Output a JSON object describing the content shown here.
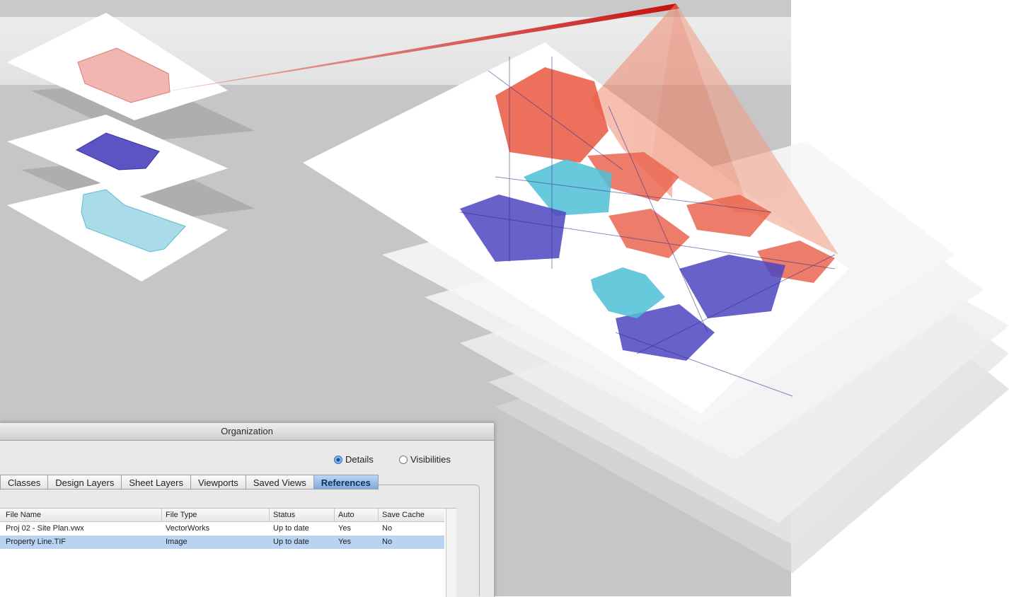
{
  "dialog": {
    "title": "Organization",
    "radios": [
      {
        "label": "Details",
        "selected": true
      },
      {
        "label": "Visibilities",
        "selected": false
      }
    ],
    "tabs": [
      {
        "label": "Classes",
        "active": false
      },
      {
        "label": "Design Layers",
        "active": false
      },
      {
        "label": "Sheet Layers",
        "active": false
      },
      {
        "label": "Viewports",
        "active": false
      },
      {
        "label": "Saved Views",
        "active": false
      },
      {
        "label": "References",
        "active": true
      }
    ],
    "table": {
      "columns": [
        "File Name",
        "File Type",
        "Status",
        "Auto",
        "Save Cache"
      ],
      "rows": [
        {
          "file_name": "Proj 02 - Site Plan.vwx",
          "file_type": "VectorWorks",
          "status": "Up to date",
          "auto": "Yes",
          "save_cache": "No",
          "selected": false
        },
        {
          "file_name": "Property Line.TIF",
          "file_type": "Image",
          "status": "Up to date",
          "auto": "Yes",
          "save_cache": "No",
          "selected": true
        }
      ]
    }
  },
  "colors": {
    "reference_red": "#d9533f",
    "layer_purple": "#4a3fb5",
    "layer_cyan": "#45b8cf",
    "highlight_circle": "#d8261e"
  }
}
